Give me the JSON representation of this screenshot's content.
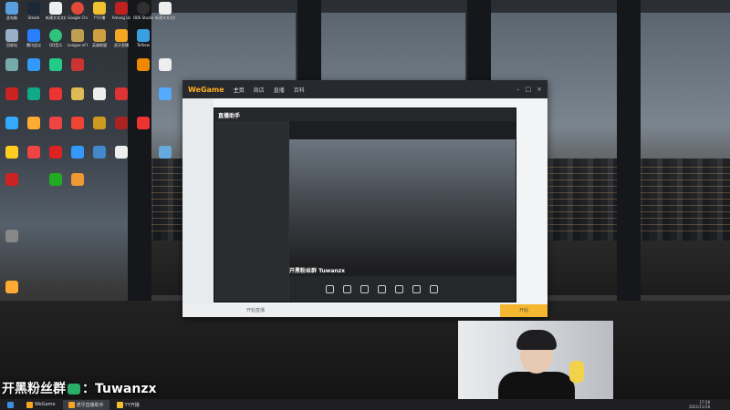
{
  "desktop": {
    "icons": [
      {
        "label": "此电脑",
        "color": "#5aa0e0"
      },
      {
        "label": "Steam",
        "color": "#1b2838"
      },
      {
        "label": "新建文本文档",
        "color": "#eeeeee"
      },
      {
        "label": "Google Chrome",
        "color": "#e04a3a"
      },
      {
        "label": "YY开播",
        "color": "#f0c030"
      },
      {
        "label": "Among Us",
        "color": "#c02020"
      },
      {
        "label": "OBS Studio",
        "color": "#303030"
      },
      {
        "label": "新建文本文档",
        "color": "#eeeeee"
      },
      {
        "label": "英雄联盟",
        "color": "#d0a040"
      },
      {
        "label": "虎牙直播",
        "color": "#f5a623"
      },
      {
        "label": "TeXiew",
        "color": "#3aa0e0"
      },
      {
        "label": "回收站",
        "color": "#9ab0c8"
      },
      {
        "label": "腾讯会议",
        "color": "#2a7fff"
      },
      {
        "label": "QQ音乐",
        "color": "#31c27c"
      },
      {
        "label": "League of Legends",
        "color": "#c0a050"
      }
    ]
  },
  "wegame": {
    "logo": "WeGame",
    "tabs": [
      "主页",
      "商店",
      "直播",
      "百科"
    ],
    "bottom_text": "开始直播",
    "orange_label": "开始"
  },
  "huya": {
    "logo": "直播助手",
    "streamer_line": "开黑粉丝群 Tuwanzx"
  },
  "taskbar": {
    "items": [
      {
        "label": "",
        "color": "#3a8fe0",
        "active": false
      },
      {
        "label": "WeGame",
        "color": "#f5a623",
        "active": false
      },
      {
        "label": "虎牙直播助手",
        "color": "#f5a623",
        "active": true
      },
      {
        "label": "YY开播",
        "color": "#f0c030",
        "active": false
      }
    ],
    "time": "17:58",
    "date": "2021/11/28"
  },
  "watermark": {
    "prefix": "开黑粉丝群",
    "suffix": "：Tuwanzx"
  }
}
